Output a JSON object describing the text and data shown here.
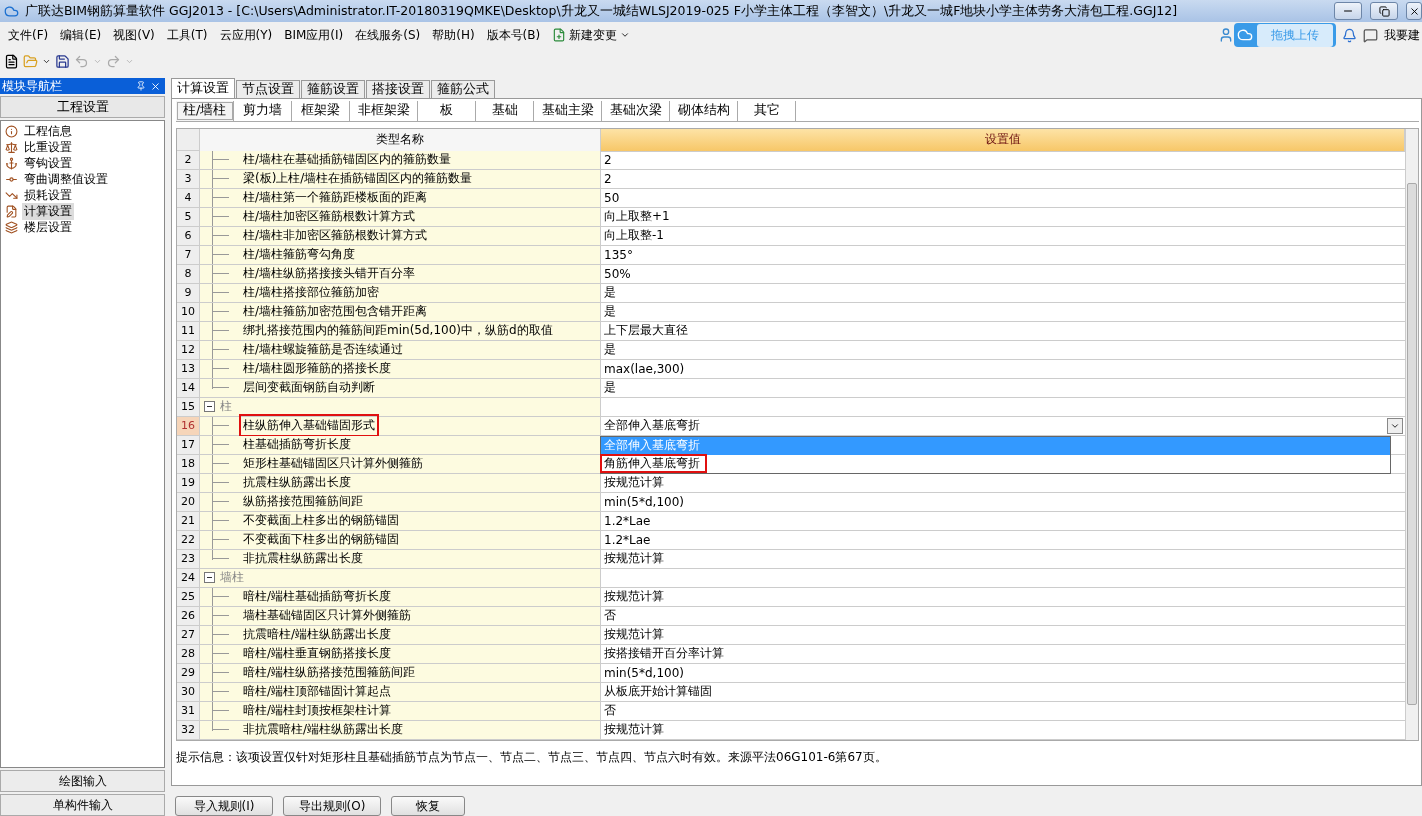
{
  "window": {
    "title": "广联达BIM钢筋算量软件 GGJ2013 - [C:\\Users\\Administrator.IT-20180319QMKE\\Desktop\\升龙又一城结WLSJ2019-025 F小学主体工程（李智文）\\升龙又一城F地块小学主体劳务大清包工程.GGJ12]"
  },
  "menu": [
    "文件(F)",
    "编辑(E)",
    "视图(V)",
    "工具(T)",
    "云应用(Y)",
    "BIM应用(I)",
    "在线服务(S)",
    "帮助(H)",
    "版本号(B)",
    "新建变更"
  ],
  "top_right": {
    "upload": "拖拽上传",
    "feedback": "我要建"
  },
  "nav": {
    "title": "模块导航栏",
    "section": "工程设置",
    "items": [
      {
        "label": "工程信息",
        "selected": false
      },
      {
        "label": "比重设置",
        "selected": false
      },
      {
        "label": "弯钩设置",
        "selected": false
      },
      {
        "label": "弯曲调整值设置",
        "selected": false
      },
      {
        "label": "损耗设置",
        "selected": false
      },
      {
        "label": "计算设置",
        "selected": true
      },
      {
        "label": "楼层设置",
        "selected": false
      }
    ],
    "bottom": [
      "绘图输入",
      "单构件输入"
    ]
  },
  "tabs": [
    {
      "label": "计算设置",
      "selected": true
    },
    {
      "label": "节点设置",
      "selected": false
    },
    {
      "label": "箍筋设置",
      "selected": false
    },
    {
      "label": "搭接设置",
      "selected": false
    },
    {
      "label": "箍筋公式",
      "selected": false
    }
  ],
  "subtabs": [
    {
      "label": "柱/墙柱",
      "selected": true
    },
    {
      "label": "剪力墙",
      "selected": false
    },
    {
      "label": "框架梁",
      "selected": false
    },
    {
      "label": "非框架梁",
      "selected": false
    },
    {
      "label": "板",
      "selected": false
    },
    {
      "label": "基础",
      "selected": false
    },
    {
      "label": "基础主梁",
      "selected": false
    },
    {
      "label": "基础次梁",
      "selected": false
    },
    {
      "label": "砌体结构",
      "selected": false
    },
    {
      "label": "其它",
      "selected": false
    }
  ],
  "table": {
    "columns": [
      "类型名称",
      "设置值"
    ],
    "rows": [
      {
        "kind": "item",
        "no": "2",
        "name": "柱/墙柱在基础插筋锚固区内的箍筋数量",
        "value": "2",
        "selected": false
      },
      {
        "kind": "item",
        "no": "3",
        "name": "梁(板)上柱/墙柱在插筋锚固区内的箍筋数量",
        "value": "2",
        "selected": false
      },
      {
        "kind": "item",
        "no": "4",
        "name": "柱/墙柱第一个箍筋距楼板面的距离",
        "value": "50",
        "selected": false
      },
      {
        "kind": "item",
        "no": "5",
        "name": "柱/墙柱加密区箍筋根数计算方式",
        "value": "向上取整+1",
        "selected": false
      },
      {
        "kind": "item",
        "no": "6",
        "name": "柱/墙柱非加密区箍筋根数计算方式",
        "value": "向上取整-1",
        "selected": false
      },
      {
        "kind": "item",
        "no": "7",
        "name": "柱/墙柱箍筋弯勾角度",
        "value": "135°",
        "selected": false
      },
      {
        "kind": "item",
        "no": "8",
        "name": "柱/墙柱纵筋搭接接头错开百分率",
        "value": "50%",
        "selected": false
      },
      {
        "kind": "item",
        "no": "9",
        "name": "柱/墙柱搭接部位箍筋加密",
        "value": "是",
        "selected": false
      },
      {
        "kind": "item",
        "no": "10",
        "name": "柱/墙柱箍筋加密范围包含错开距离",
        "value": "是",
        "selected": false
      },
      {
        "kind": "item",
        "no": "11",
        "name": "绑扎搭接范围内的箍筋间距min(5d,100)中，纵筋d的取值",
        "value": "上下层最大直径",
        "selected": false
      },
      {
        "kind": "item",
        "no": "12",
        "name": "柱/墙柱螺旋箍筋是否连续通过",
        "value": "是",
        "selected": false
      },
      {
        "kind": "item",
        "no": "13",
        "name": "柱/墙柱圆形箍筋的搭接长度",
        "value": "max(lae,300)",
        "selected": false
      },
      {
        "kind": "item",
        "no": "14",
        "name": "层间变截面钢筋自动判断",
        "value": "是",
        "selected": false
      },
      {
        "kind": "group",
        "no": "15",
        "name": "柱",
        "expanded": true,
        "selected": false
      },
      {
        "kind": "item",
        "no": "16",
        "name": "柱纵筋伸入基础锚固形式",
        "value": "全部伸入基底弯折",
        "selected": true,
        "annotated": true
      },
      {
        "kind": "item",
        "no": "17",
        "name": "柱基础插筋弯折长度",
        "selected": false
      },
      {
        "kind": "item",
        "no": "18",
        "name": "矩形柱基础锚固区只计算外侧箍筋",
        "selected": false
      },
      {
        "kind": "item",
        "no": "19",
        "name": "抗震柱纵筋露出长度",
        "value": "按规范计算",
        "selected": false
      },
      {
        "kind": "item",
        "no": "20",
        "name": "纵筋搭接范围箍筋间距",
        "value": "min(5*d,100)",
        "selected": false
      },
      {
        "kind": "item",
        "no": "21",
        "name": "不变截面上柱多出的钢筋锚固",
        "value": "1.2*Lae",
        "selected": false
      },
      {
        "kind": "item",
        "no": "22",
        "name": "不变截面下柱多出的钢筋锚固",
        "value": "1.2*Lae",
        "selected": false
      },
      {
        "kind": "item",
        "no": "23",
        "name": "非抗震柱纵筋露出长度",
        "value": "按规范计算",
        "selected": false
      },
      {
        "kind": "group",
        "no": "24",
        "name": "墙柱",
        "expanded": true,
        "selected": false
      },
      {
        "kind": "item",
        "no": "25",
        "name": "暗柱/端柱基础插筋弯折长度",
        "value": "按规范计算",
        "selected": false
      },
      {
        "kind": "item",
        "no": "26",
        "name": "墙柱基础锚固区只计算外侧箍筋",
        "value": "否",
        "selected": false
      },
      {
        "kind": "item",
        "no": "27",
        "name": "抗震暗柱/端柱纵筋露出长度",
        "value": "按规范计算",
        "selected": false
      },
      {
        "kind": "item",
        "no": "28",
        "name": "暗柱/端柱垂直钢筋搭接长度",
        "value": "按搭接错开百分率计算",
        "selected": false
      },
      {
        "kind": "item",
        "no": "29",
        "name": "暗柱/端柱纵筋搭接范围箍筋间距",
        "value": "min(5*d,100)",
        "selected": false
      },
      {
        "kind": "item",
        "no": "30",
        "name": "暗柱/端柱顶部锚固计算起点",
        "value": "从板底开始计算锚固",
        "selected": false
      },
      {
        "kind": "item",
        "no": "31",
        "name": "暗柱/端柱封顶按框架柱计算",
        "value": "否",
        "selected": false
      },
      {
        "kind": "item",
        "no": "32",
        "name": "非抗震暗柱/端柱纵筋露出长度",
        "value": "按规范计算",
        "selected": false
      }
    ],
    "dropdown": {
      "options": [
        {
          "label": "全部伸入基底弯折",
          "selected": true,
          "annotated": false
        },
        {
          "label": "角筋伸入基底弯折",
          "selected": false,
          "annotated": true
        }
      ]
    }
  },
  "hint": "提示信息：该项设置仅针对矩形柱且基础插筋节点为节点一、节点二、节点三、节点四、节点六时有效。来源平法06G101-6第67页。",
  "buttons": [
    "导入规则(I)",
    "导出规则(O)",
    "恢复"
  ]
}
